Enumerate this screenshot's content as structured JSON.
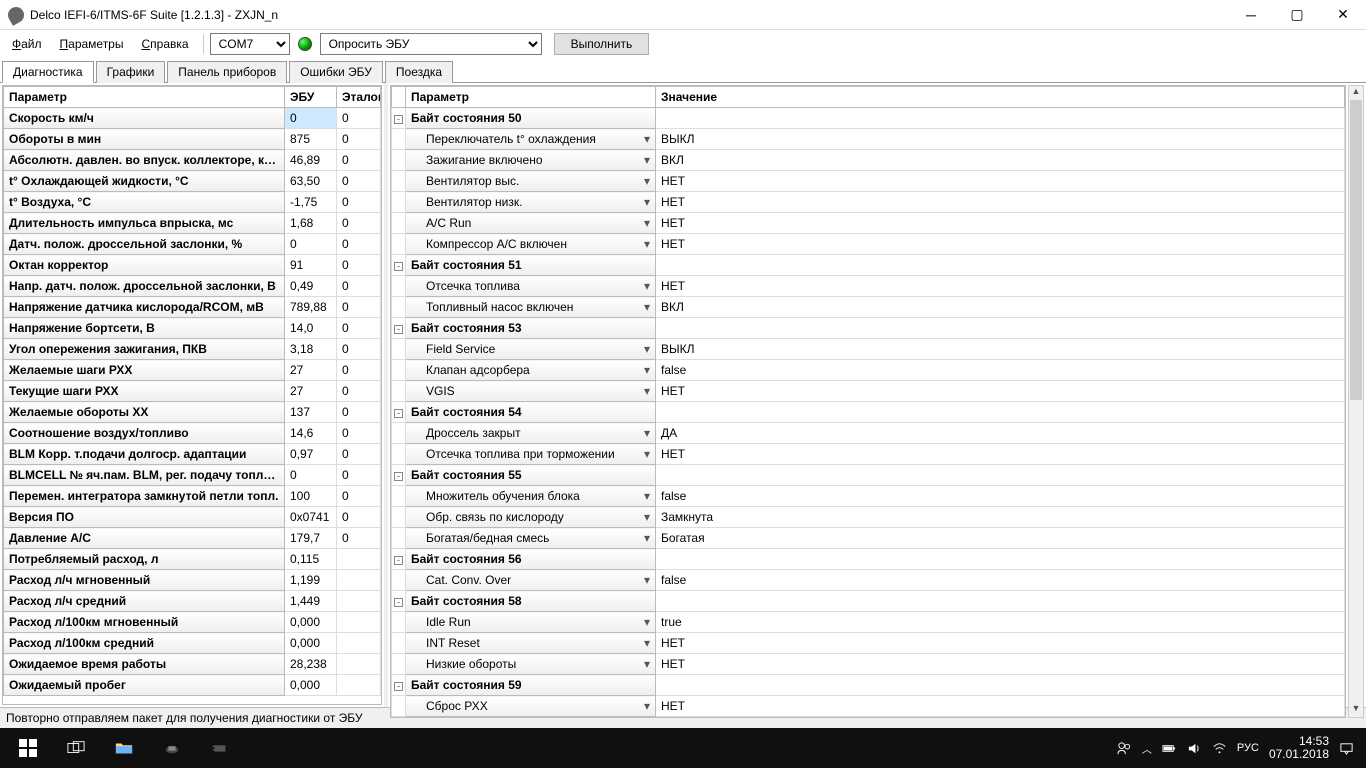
{
  "window_title": "Delco IEFI-6/ITMS-6F Suite [1.2.1.3] - ZXJN_n",
  "menu": {
    "file": "Файл",
    "params": "Параметры",
    "help": "Справка"
  },
  "toolbar": {
    "port": "COM7",
    "action": "Опросить ЭБУ",
    "exec": "Выполнить"
  },
  "tabs": [
    "Диагностика",
    "Графики",
    "Панель приборов",
    "Ошибки ЭБУ",
    "Поездка"
  ],
  "left": {
    "headers": [
      "Параметр",
      "ЭБУ",
      "Эталон"
    ],
    "rows": [
      {
        "p": "Скорость км/ч",
        "v": "0",
        "e": "0",
        "sel": true
      },
      {
        "p": "Обороты в мин",
        "v": "875",
        "e": "0"
      },
      {
        "p": "Абсолютн. давлен. во впуск. коллекторе, кПа",
        "v": "46,89",
        "e": "0"
      },
      {
        "p": "t° Охлаждающей жидкости, °С",
        "v": "63,50",
        "e": "0"
      },
      {
        "p": "t° Воздуха, °С",
        "v": "-1,75",
        "e": "0"
      },
      {
        "p": "Длительность импульса впрыска, мс",
        "v": "1,68",
        "e": "0"
      },
      {
        "p": "Датч. полож. дроссельной заслонки, %",
        "v": "0",
        "e": "0"
      },
      {
        "p": "Октан корректор",
        "v": "91",
        "e": "0"
      },
      {
        "p": "Напр. датч. полож. дроссельной заслонки, В",
        "v": "0,49",
        "e": "0"
      },
      {
        "p": "Напряжение датчика кислорода/RCOM, мВ",
        "v": "789,88",
        "e": "0"
      },
      {
        "p": "Напряжение бортсети, В",
        "v": "14,0",
        "e": "0"
      },
      {
        "p": "Угол опережения зажигания, ПКВ",
        "v": "3,18",
        "e": "0"
      },
      {
        "p": "Желаемые шаги РХХ",
        "v": "27",
        "e": "0"
      },
      {
        "p": "Текущие шаги РХХ",
        "v": "27",
        "e": "0"
      },
      {
        "p": "Желаемые обороты ХХ",
        "v": "137",
        "e": "0"
      },
      {
        "p": "Соотношение воздух/топливо",
        "v": "14,6",
        "e": "0"
      },
      {
        "p": "BLM Корр. т.подачи долгоср. адаптации",
        "v": "0,97",
        "e": "0"
      },
      {
        "p": "BLMCELL № яч.пам. BLM, рег. подачу топлива",
        "v": "0",
        "e": "0"
      },
      {
        "p": "Перемен. интегратора замкнутой петли топл.",
        "v": "100",
        "e": "0"
      },
      {
        "p": "Версия ПО",
        "v": "0x0741",
        "e": "0"
      },
      {
        "p": "Давление А/С",
        "v": "179,7",
        "e": "0"
      },
      {
        "p": "Потребляемый расход, л",
        "v": "0,115",
        "e": ""
      },
      {
        "p": "Расход л/ч мгновенный",
        "v": "1,199",
        "e": ""
      },
      {
        "p": "Расход л/ч средний",
        "v": "1,449",
        "e": ""
      },
      {
        "p": "Расход л/100км мгновенный",
        "v": "0,000",
        "e": ""
      },
      {
        "p": "Расход л/100км средний",
        "v": "0,000",
        "e": ""
      },
      {
        "p": "Ожидаемое время работы",
        "v": "28,238",
        "e": ""
      },
      {
        "p": "Ожидаемый пробег",
        "v": "0,000",
        "e": ""
      }
    ]
  },
  "right": {
    "headers": [
      "Параметр",
      "Значение"
    ],
    "rows": [
      {
        "p": "Байт состояния 50",
        "v": "",
        "hdr": true,
        "t": "-"
      },
      {
        "p": "Переключатель t° охлаждения",
        "v": "ВЫКЛ",
        "dd": true
      },
      {
        "p": "Зажигание включено",
        "v": "ВКЛ",
        "dd": true
      },
      {
        "p": "Вентилятор выс.",
        "v": "НЕТ",
        "dd": true
      },
      {
        "p": "Вентилятор низк.",
        "v": "НЕТ",
        "dd": true
      },
      {
        "p": "A/C Run",
        "v": "НЕТ",
        "dd": true
      },
      {
        "p": "Компрессор А/С включен",
        "v": "НЕТ",
        "dd": true
      },
      {
        "p": "Байт состояния 51",
        "v": "",
        "hdr": true,
        "t": "-"
      },
      {
        "p": "Отсечка топлива",
        "v": "НЕТ",
        "dd": true
      },
      {
        "p": "Топливный насос включен",
        "v": "ВКЛ",
        "dd": true
      },
      {
        "p": "Байт состояния 53",
        "v": "",
        "hdr": true,
        "t": "-"
      },
      {
        "p": "Field Service",
        "v": "ВЫКЛ",
        "dd": true
      },
      {
        "p": "Клапан адсорбера",
        "v": "false",
        "dd": true
      },
      {
        "p": "VGIS",
        "v": "НЕТ",
        "dd": true
      },
      {
        "p": "Байт состояния 54",
        "v": "",
        "hdr": true,
        "t": "-"
      },
      {
        "p": "Дроссель закрыт",
        "v": "ДА",
        "dd": true
      },
      {
        "p": "Отсечка топлива при торможении",
        "v": "НЕТ",
        "dd": true
      },
      {
        "p": "Байт состояния 55",
        "v": "",
        "hdr": true,
        "t": "-"
      },
      {
        "p": "Множитель обучения блока",
        "v": "false",
        "dd": true
      },
      {
        "p": "Обр. связь по кислороду",
        "v": "Замкнута",
        "dd": true
      },
      {
        "p": "Богатая/бедная смесь",
        "v": "Богатая",
        "dd": true
      },
      {
        "p": "Байт состояния 56",
        "v": "",
        "hdr": true,
        "t": "-"
      },
      {
        "p": "Cat. Conv. Over",
        "v": "false",
        "dd": true
      },
      {
        "p": "Байт состояния 58",
        "v": "",
        "hdr": true,
        "t": "-"
      },
      {
        "p": "Idle Run",
        "v": "true",
        "dd": true
      },
      {
        "p": "INT Reset",
        "v": "НЕТ",
        "dd": true
      },
      {
        "p": "Низкие обороты",
        "v": "НЕТ",
        "dd": true
      },
      {
        "p": "Байт состояния 59",
        "v": "",
        "hdr": true,
        "t": "-"
      },
      {
        "p": "Сброс РХХ",
        "v": "НЕТ",
        "dd": true
      }
    ]
  },
  "status": "Повторно отправляем пакет для получения диагностики от ЭБУ",
  "taskbar": {
    "lang": "РУС",
    "time": "14:53",
    "date": "07.01.2018"
  }
}
